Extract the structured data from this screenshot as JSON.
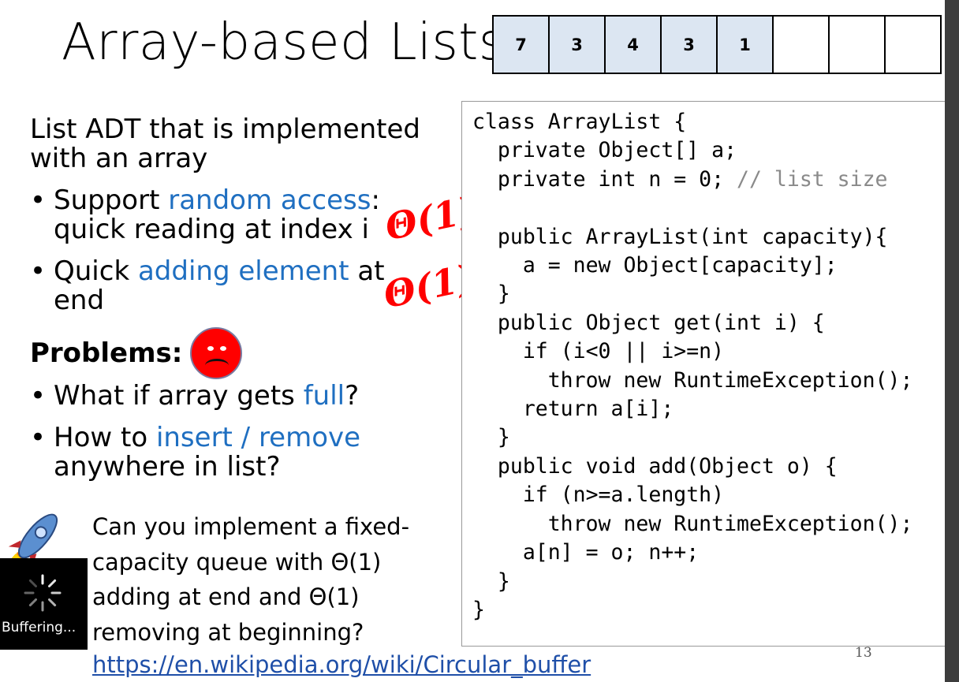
{
  "slide": {
    "title": "Array-based Lists",
    "array_cells": [
      "7",
      "3",
      "4",
      "3",
      "1",
      "",
      "",
      ""
    ],
    "heading": "List ADT that is implemented with an array",
    "bullets": [
      {
        "pre": "Support ",
        "highlight": "random access",
        "post": ": quick reading at  index i"
      },
      {
        "pre": "Quick ",
        "highlight": "adding element",
        "post": " at end"
      }
    ],
    "problems_label": "Problems:",
    "problem_bullets": [
      {
        "pre": "What if array gets ",
        "highlight": "full",
        "post": "?"
      },
      {
        "pre": "How to ",
        "highlight": "insert / remove",
        "post": " anywhere in list?"
      }
    ],
    "theta_annotation_1": "Θ(1)",
    "theta_annotation_2": "Θ(1)",
    "code_lines": [
      "class ArrayList {",
      "  private Object[] a;",
      "  private int n = 0; ",
      "",
      "  public ArrayList(int capacity){",
      "    a = new Object[capacity];",
      "  }",
      "  public Object get(int i) {",
      "    if (i<0 || i>=n)",
      "      throw new RuntimeException();",
      "    return a[i];",
      "  }",
      "  public void add(Object o) {",
      "    if (n>=a.length)",
      "      throw new RuntimeException();",
      "    a[n] = o; n++;",
      "  }",
      "}"
    ],
    "code_comment": "// list size",
    "buffering_label": "Buffering...",
    "question": "Can you implement a fixed-capacity queue with Θ(1) adding at end and Θ(1) removing at beginning?",
    "link": "https://en.wikipedia.org/wiki/Circular_buffer",
    "page_number": "13"
  },
  "colors": {
    "accent_blue": "#1f6fc1",
    "theta_red": "#ff0000",
    "cell_fill": "#dce6f2"
  },
  "icons": [
    "sad-face-icon",
    "rocket-icon",
    "buffering-spinner-icon"
  ]
}
